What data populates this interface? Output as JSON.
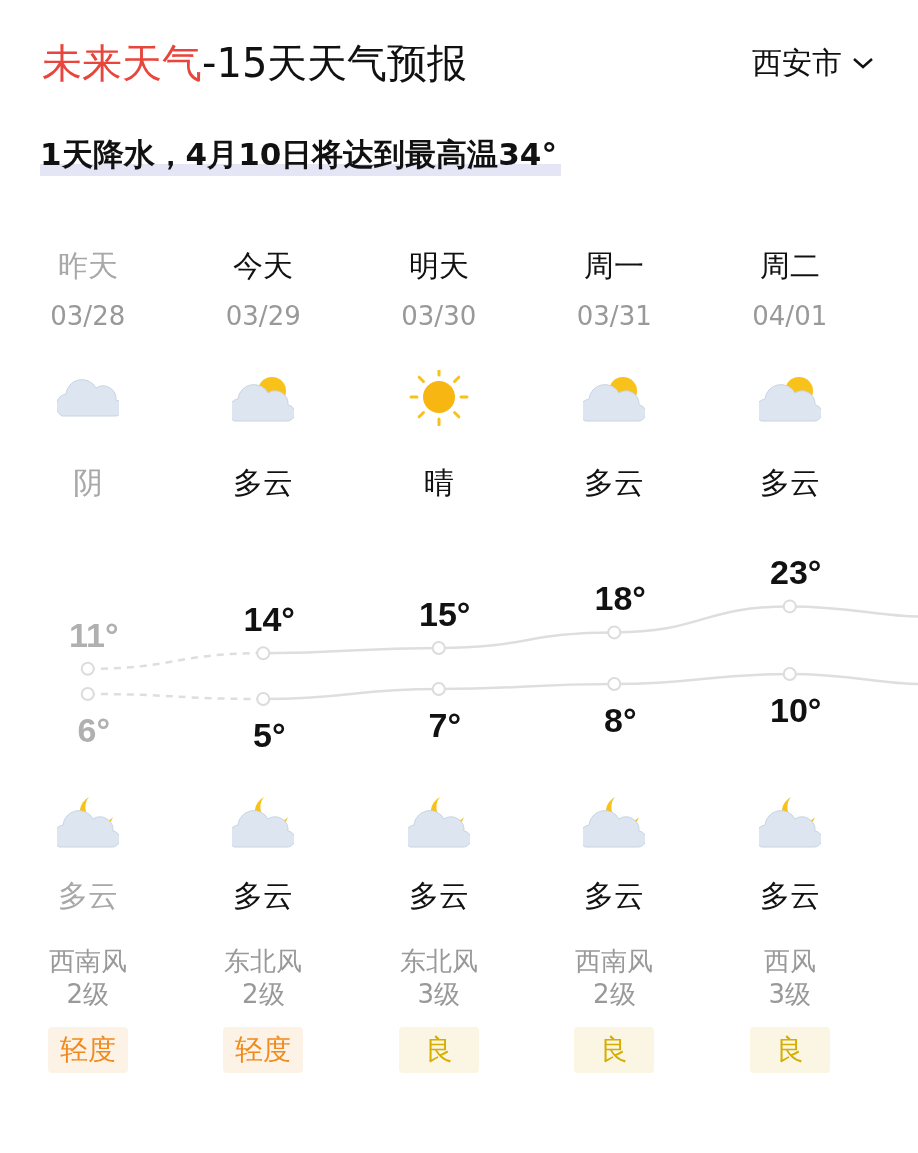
{
  "header": {
    "title_accent": "未来天气",
    "title_rest": "-15天天气预报",
    "city": "西安市"
  },
  "summary": "1天降水，4月10日将达到最高温34°",
  "days": [
    {
      "name": "昨天",
      "date": "03/28",
      "past": true,
      "day": {
        "kind": "cloud",
        "text": "阴"
      },
      "high": "11°",
      "low": "6°",
      "night": {
        "kind": "moon_cloud",
        "text": "多云"
      },
      "wind": "西南风",
      "wind_level": "2级",
      "aqi": {
        "text": "轻度",
        "color": "#f08a1c"
      }
    },
    {
      "name": "今天",
      "date": "03/29",
      "past": false,
      "day": {
        "kind": "sun_cloud",
        "text": "多云"
      },
      "high": "14°",
      "low": "5°",
      "night": {
        "kind": "moon_cloud",
        "text": "多云"
      },
      "wind": "东北风",
      "wind_level": "2级",
      "aqi": {
        "text": "轻度",
        "color": "#f08a1c"
      }
    },
    {
      "name": "明天",
      "date": "03/30",
      "past": false,
      "day": {
        "kind": "sun",
        "text": "晴"
      },
      "high": "15°",
      "low": "7°",
      "night": {
        "kind": "moon_cloud",
        "text": "多云"
      },
      "wind": "东北风",
      "wind_level": "3级",
      "aqi": {
        "text": "良",
        "color": "#d6ad00"
      }
    },
    {
      "name": "周一",
      "date": "03/31",
      "past": false,
      "day": {
        "kind": "sun_cloud",
        "text": "多云"
      },
      "high": "18°",
      "low": "8°",
      "night": {
        "kind": "moon_cloud",
        "text": "多云"
      },
      "wind": "西南风",
      "wind_level": "2级",
      "aqi": {
        "text": "良",
        "color": "#d6ad00"
      }
    },
    {
      "name": "周二",
      "date": "04/01",
      "past": false,
      "day": {
        "kind": "sun_cloud",
        "text": "多云"
      },
      "high": "23°",
      "low": "10°",
      "night": {
        "kind": "moon_cloud",
        "text": "多云"
      },
      "wind": "西风",
      "wind_level": "3级",
      "aqi": {
        "text": "良",
        "color": "#d6ad00"
      }
    }
  ]
}
